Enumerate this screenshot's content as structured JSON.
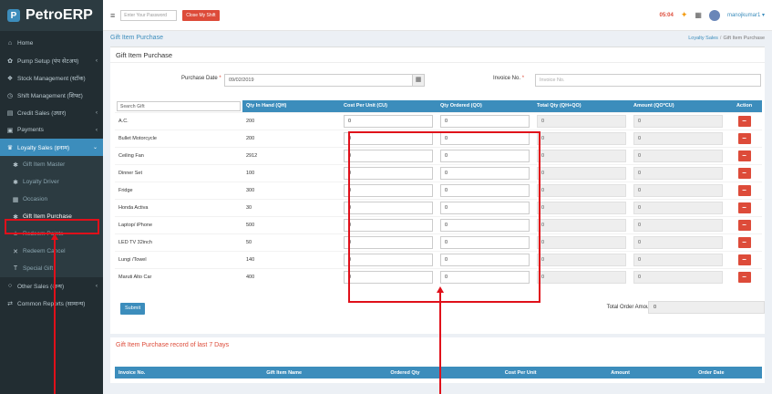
{
  "app": {
    "logo_text": "PetroERP",
    "logo_icon": "P"
  },
  "sidebar": {
    "items": [
      {
        "label": "Home",
        "icon": "home-icon",
        "glyph": "⌂"
      },
      {
        "label": "Pump Setup (पंप सेटअप)",
        "icon": "gears-icon",
        "glyph": "✿",
        "arrow": "‹"
      },
      {
        "label": "Stock Management (स्टॉक)",
        "icon": "cubes-icon",
        "glyph": "❖"
      },
      {
        "label": "Shift Management (शिफ्ट)",
        "icon": "clock-icon",
        "glyph": "◷"
      },
      {
        "label": "Credit Sales (उधार)",
        "icon": "card-icon",
        "glyph": "▤",
        "arrow": "‹"
      },
      {
        "label": "Payments",
        "icon": "payments-icon",
        "glyph": "▣",
        "arrow": "‹"
      },
      {
        "label": "Loyalty Sales (इनाम)",
        "icon": "trophy-icon",
        "glyph": "♛",
        "arrow": "⌄",
        "active": true
      },
      {
        "label": "Gift Item Master",
        "icon": "gift-icon",
        "glyph": "✱",
        "sub": true
      },
      {
        "label": "Loyalty Driver",
        "icon": "gift-icon",
        "glyph": "✱",
        "sub": true
      },
      {
        "label": "Occasion",
        "icon": "calendar-icon",
        "glyph": "▦",
        "sub": true
      },
      {
        "label": "Gift Item Purchase",
        "icon": "gift-icon",
        "glyph": "✱",
        "sub": true,
        "current": true
      },
      {
        "label": "Redeem Points",
        "icon": "redeem-icon",
        "glyph": "±",
        "sub": true
      },
      {
        "label": "Redeem Cancel",
        "icon": "cancel-icon",
        "glyph": "✕",
        "sub": true
      },
      {
        "label": "Special Gift",
        "icon": "special-gift-icon",
        "glyph": "T",
        "sub": true
      },
      {
        "label": "Other Sales (अन्य)",
        "icon": "circle-icon",
        "glyph": "○",
        "arrow": "‹"
      },
      {
        "label": "Common Reports (सामान्य)",
        "icon": "reports-icon",
        "glyph": "⇄"
      }
    ]
  },
  "topbar": {
    "password_placeholder": "Enter Your Password",
    "close_shift_label": "Close My Shift",
    "clock": "05:04",
    "username": "manojkumar1 ▾"
  },
  "page": {
    "header_title": "Gift Item Purchase",
    "breadcrumb": [
      "Loyalty Sales",
      "Gift Item Purchase"
    ],
    "card_title": "Gift Item Purchase"
  },
  "form": {
    "purchase_date_label": "Purchase Date",
    "purchase_date_value": "09/02/2019",
    "invoice_label": "Invoice No.",
    "invoice_placeholder": "Invoice No.",
    "required_mark": "*"
  },
  "table": {
    "search_placeholder": "Search Gift",
    "columns": [
      "Qty In Hand (QH)",
      "Cost Per Unit (CU)",
      "Qty Ordered (QO)",
      "Total Qty (QH+QO)",
      "Amount (QO*CU)",
      "Action"
    ],
    "rows": [
      {
        "item": "A.C.",
        "qh": "200",
        "cu": "0",
        "qo": "0",
        "total": "0",
        "amount": "0"
      },
      {
        "item": "Bullet Motorcycle",
        "qh": "200",
        "cu": "0",
        "qo": "0",
        "total": "0",
        "amount": "0"
      },
      {
        "item": "Ceiling Fan",
        "qh": "2912",
        "cu": "0",
        "qo": "0",
        "total": "0",
        "amount": "0"
      },
      {
        "item": "Dinner Set",
        "qh": "100",
        "cu": "0",
        "qo": "0",
        "total": "0",
        "amount": "0"
      },
      {
        "item": "Fridge",
        "qh": "300",
        "cu": "0",
        "qo": "0",
        "total": "0",
        "amount": "0"
      },
      {
        "item": "Honda Activa",
        "qh": "30",
        "cu": "0",
        "qo": "0",
        "total": "0",
        "amount": "0"
      },
      {
        "item": "Laptop/ iPhone",
        "qh": "500",
        "cu": "0",
        "qo": "0",
        "total": "0",
        "amount": "0"
      },
      {
        "item": "LED TV 32inch",
        "qh": "50",
        "cu": "0",
        "qo": "0",
        "total": "0",
        "amount": "0"
      },
      {
        "item": "Lungi /Towel",
        "qh": "140",
        "cu": "0",
        "qo": "0",
        "total": "0",
        "amount": "0"
      },
      {
        "item": "Maruti Alto Car",
        "qh": "400",
        "cu": "0",
        "qo": "0",
        "total": "0",
        "amount": "0"
      }
    ],
    "remove_label": "−"
  },
  "footer": {
    "submit_label": "Submit",
    "total_label": "Total Order Amount Rs.",
    "total_value": "0"
  },
  "records": {
    "title": "Gift Item Purchase record of last 7 Days",
    "columns": [
      "Invoice No.",
      "Gift Item Name",
      "Ordered Qty",
      "Cost Per Unit",
      "Amount",
      "Order Date"
    ]
  },
  "colors": {
    "primary": "#3c8dbc",
    "danger": "#dd4b39",
    "sidebar": "#222d32",
    "highlight": "#e0101a"
  }
}
